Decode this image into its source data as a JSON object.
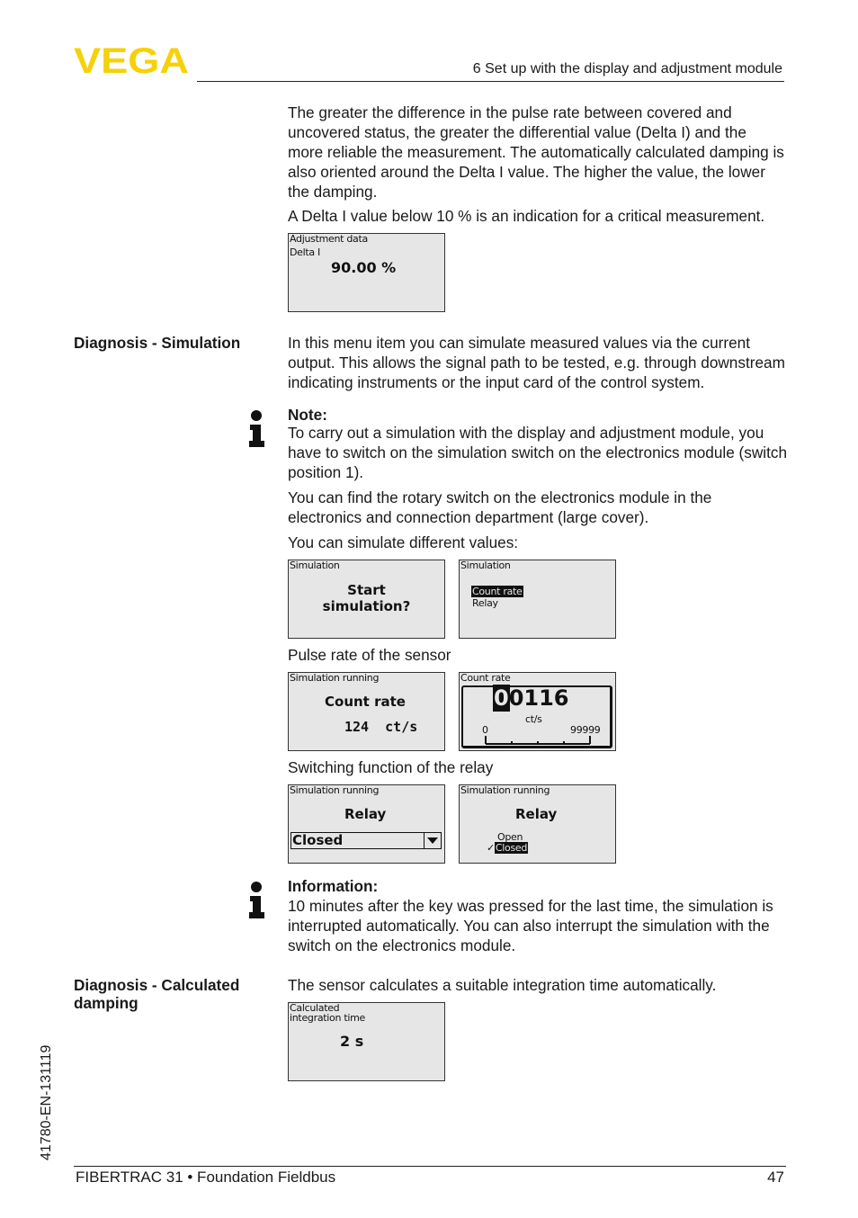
{
  "header": {
    "brand": "VEGA",
    "brand_color": "#f5d10a",
    "chapter": "6 Set up with the display and adjustment module"
  },
  "intro": {
    "paragraph1": "The greater the difference in the pulse rate between covered and uncovered status, the greater the differential value (Delta I) and the more reliable the measurement. The automatically calculated damping is also oriented around the Delta I value. The higher the value, the lower the damping.",
    "paragraph2": "A Delta I value below 10 % is an indication for a critical measurement."
  },
  "lcd_delta": {
    "line1": "Adjustment data",
    "line2": "Delta I",
    "value": "90.00 %"
  },
  "simulation": {
    "heading": "Diagnosis - Simulation",
    "text": "In this menu item you can simulate measured values via the current output. This allows the signal path to be tested, e.g. through downstream indicating instruments or the input card of the control system.",
    "note_title": "Note:",
    "note_text": "To carry out a simulation with the display and adjustment module, you have to switch on the simulation switch on the electronics module (switch position 1).",
    "rotary_text": "You can find the rotary switch on the electronics module in the electronics and connection department (large cover).",
    "values_text": "You can simulate different values:",
    "lcd_start": {
      "title": "Simulation",
      "line1": "Start",
      "line2": "simulation?"
    },
    "lcd_menu": {
      "title": "Simulation",
      "items": [
        "Count rate",
        "Relay"
      ],
      "selected": "Count rate"
    },
    "pulse_caption": "Pulse rate of the sensor",
    "lcd_running_count": {
      "title": "Simulation running",
      "label": "Count rate",
      "value": "124  ct/s"
    },
    "lcd_count_edit": {
      "title": "Count rate",
      "cursor_digit": "0",
      "rest_digits": "0116",
      "unit": "ct/s",
      "scale_min": "0",
      "scale_max": "99999"
    },
    "relay_caption": "Switching function of the relay",
    "lcd_relay_select": {
      "title": "Simulation running",
      "label": "Relay",
      "value": "Closed"
    },
    "lcd_relay_options": {
      "title": "Simulation running",
      "label": "Relay",
      "options": [
        "Open",
        "Closed"
      ],
      "checked": "Closed"
    },
    "info_title": "Information:",
    "info_text": "10 minutes after the key was pressed for the last time, the simulation is interrupted automatically. You can also interrupt the simulation with the switch on the electronics module."
  },
  "damping": {
    "heading": "Diagnosis - Calculated damping",
    "text": "The sensor calculates a suitable integration time automatically.",
    "lcd": {
      "line1": "Calculated",
      "line2": "integration time",
      "value": "2 s"
    }
  },
  "footer": {
    "doc_id": "41780-EN-131119",
    "product": "FIBERTRAC 31 • Foundation Fieldbus",
    "page": "47"
  }
}
